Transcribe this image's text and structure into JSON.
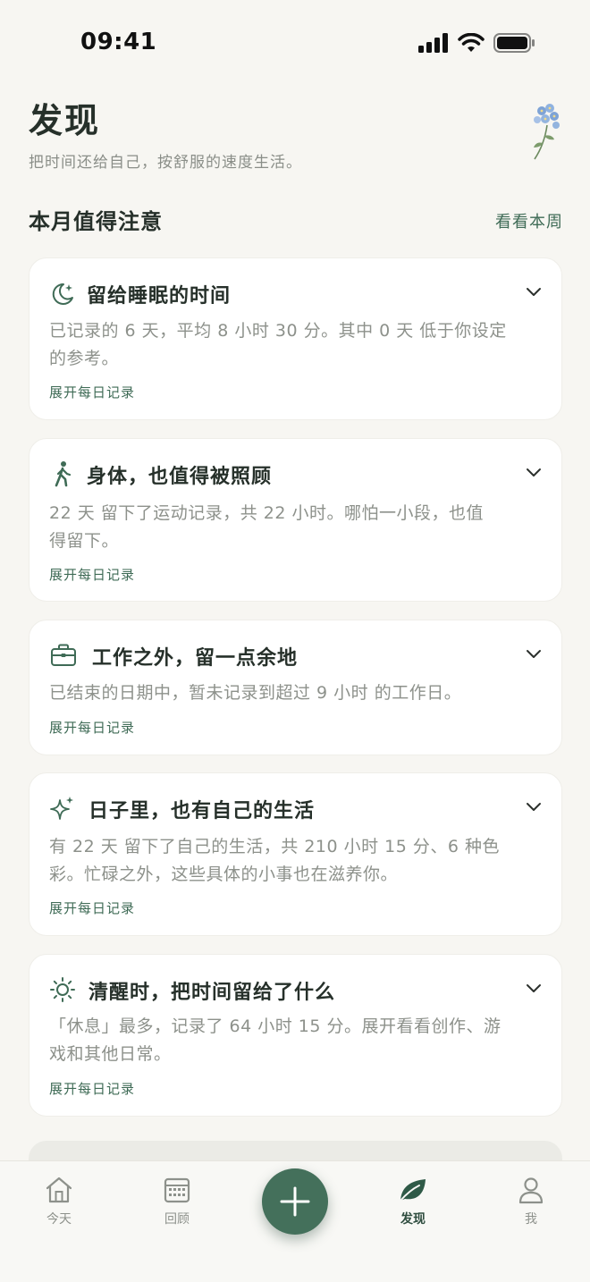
{
  "status_bar": {
    "time": "09:41"
  },
  "header": {
    "title": "发现",
    "subtitle": "把时间还给自己，按舒服的速度生活。"
  },
  "section": {
    "title": "本月值得注意",
    "link": "看看本周"
  },
  "cards": [
    {
      "icon": "moon-icon",
      "title": "留给睡眠的时间",
      "desc_line1": "已记录的 6 天，平均 8 小时 30 分。其中 0 天 低于你设定",
      "desc_line2": "的参考。",
      "link": "展开每日记录"
    },
    {
      "icon": "walking-icon",
      "title": "身体，也值得被照顾",
      "desc_line1": "22 天 留下了运动记录，共 22 小时。哪怕一小段，也值",
      "desc_line2": "得留下。",
      "link": "展开每日记录"
    },
    {
      "icon": "briefcase-icon",
      "title": "工作之外，留一点余地",
      "desc_line1": "已结束的日期中，暂未记录到超过 9 小时 的工作日。",
      "desc_line2": "",
      "link": "展开每日记录"
    },
    {
      "icon": "sparkle-icon",
      "title": "日子里，也有自己的生活",
      "desc_line1": "有 22 天 留下了自己的生活，共 210 小时 15 分、6 种色",
      "desc_line2": "彩。忙碌之外，这些具体的小事也在滋养你。",
      "link": "展开每日记录"
    },
    {
      "icon": "sun-icon",
      "title": "清醒时，把时间留给了什么",
      "desc_line1": "「休息」最多，记录了 64 小时 15 分。展开看看创作、游",
      "desc_line2": "戏和其他日常。",
      "link": "展开每日记录"
    }
  ],
  "tabs": [
    {
      "icon": "home-icon",
      "label": "今天",
      "active": false
    },
    {
      "icon": "calendar-icon",
      "label": "回顾",
      "active": false
    },
    {
      "icon": "plus-icon",
      "label": "",
      "active": false
    },
    {
      "icon": "leaf-icon",
      "label": "发现",
      "active": true
    },
    {
      "icon": "person-icon",
      "label": "我",
      "active": false
    }
  ],
  "colors": {
    "background": "#f7f6f2",
    "accent": "#44705b",
    "link": "#3f6b56",
    "text_primary": "#26302a",
    "text_secondary": "#8d918b"
  }
}
